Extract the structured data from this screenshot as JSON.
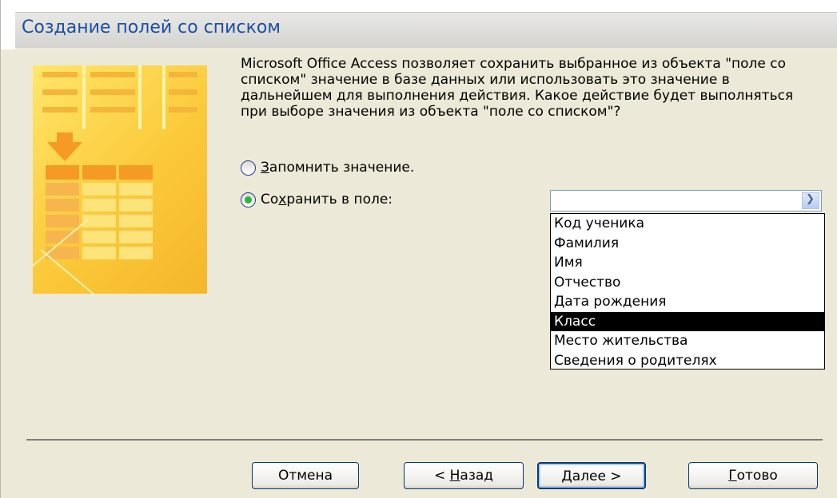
{
  "window": {
    "title": "Создание полей со списком"
  },
  "description": "Microsoft Office Access позволяет сохранить выбранное из объекта \"поле со списком\" значение в базе данных или использовать это значение в дальнейшем для выполнения действия.  Какое действие будет выполняться при выборе значения из объекта \"поле со списком\"?",
  "options": {
    "remember": {
      "pre": "",
      "hot": "З",
      "post": "апомнить значение.",
      "selected": false
    },
    "save": {
      "pre": "Со",
      "hot": "х",
      "post": "ранить в поле:",
      "selected": true
    }
  },
  "combo": {
    "value": "",
    "dropdown_icon": "chevron-down-icon"
  },
  "list": {
    "items": [
      "Код ученика",
      "Фамилия",
      "Имя",
      "Отчество",
      "Дата рождения",
      "Класс",
      "Место жительства",
      "Сведения о родителях"
    ],
    "selected_index": 5
  },
  "buttons": {
    "cancel": {
      "label": "Отмена"
    },
    "back": {
      "pre": "< ",
      "hot": "Н",
      "post": "азад"
    },
    "next": {
      "pre": "",
      "hot": "Д",
      "post": "алее >"
    },
    "finish": {
      "pre": "",
      "hot": "Г",
      "post": "отово"
    }
  },
  "colors": {
    "title_text": "#1c4fa3",
    "dialog_bg": "#ece9d8",
    "radio_dot": "#2db63b",
    "selection_bg": "#000000"
  }
}
